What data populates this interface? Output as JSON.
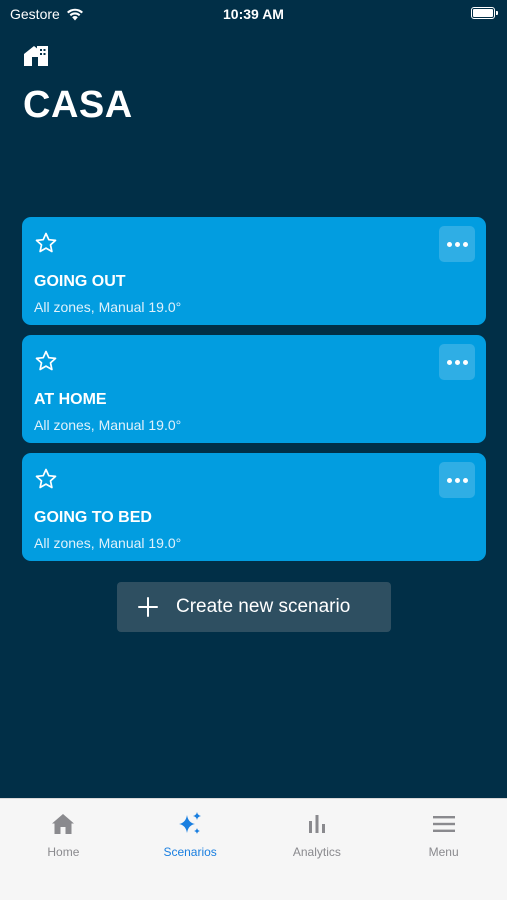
{
  "status_bar": {
    "carrier": "Gestore",
    "time": "10:39 AM"
  },
  "header": {
    "title": "CASA"
  },
  "scenarios": [
    {
      "name": "GOING OUT",
      "detail": "All zones, Manual 19.0°"
    },
    {
      "name": "AT HOME",
      "detail": "All zones, Manual 19.0°"
    },
    {
      "name": "GOING TO BED",
      "detail": "All zones, Manual 19.0°"
    }
  ],
  "create_button": {
    "label": "Create new scenario"
  },
  "tab_bar": {
    "tabs": [
      {
        "label": "Home",
        "icon": "house-icon",
        "active": false
      },
      {
        "label": "Scenarios",
        "icon": "sparkles-icon",
        "active": true
      },
      {
        "label": "Analytics",
        "icon": "bar-chart-icon",
        "active": false
      },
      {
        "label": "Menu",
        "icon": "hamburger-icon",
        "active": false
      }
    ]
  },
  "colors": {
    "background": "#012f47",
    "card": "#029de0",
    "create_button": "#2e4f61",
    "tab_bar": "#f6f6f6",
    "tab_active": "#1a7fe0",
    "tab_inactive": "#8a8a8e"
  }
}
